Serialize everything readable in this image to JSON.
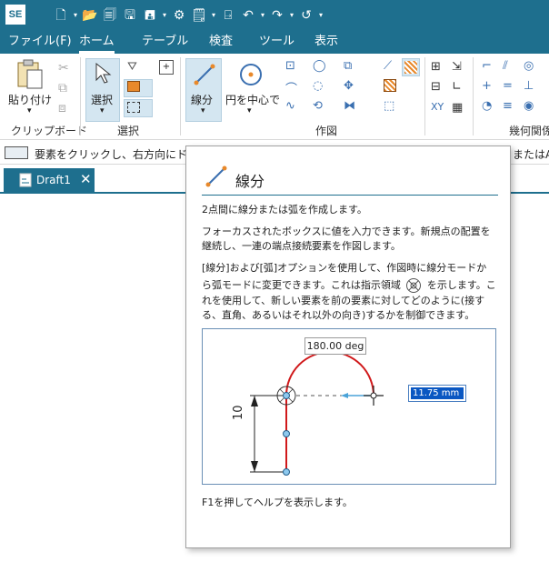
{
  "app": {
    "logo": "SE"
  },
  "tabs": [
    "ファイル(F)",
    "ホーム",
    "テーブル",
    "検査",
    "ツール",
    "表示"
  ],
  "ribbon": {
    "paste_label": "貼り付け",
    "clipboard_group": "クリップボード",
    "select_label": "選択",
    "select_group": "選択",
    "line_label": "線分",
    "circle_label": "円を中心で",
    "draw_group": "作図",
    "xy_label": "XY",
    "relations_group": "幾何関係"
  },
  "prompt": {
    "text": "要素をクリックし、右方向にドラッ",
    "text_right": "またはA"
  },
  "document": {
    "tab_label": "Draft1",
    "close_glyph": "✕"
  },
  "tooltip": {
    "title": "線分",
    "p1": "2点間に線分または弧を作成します。",
    "p2_line1": "フォーカスされたボックスに値を入力できます。新規点の配置を",
    "p2_line2": "継続し、一連の端点接続要素を作図します。",
    "p3_line1": "[線分]および[弧]オプションを使用して、作図時に線分モードか",
    "p3_line2a": "ら弧モードに変更できます。これは指示領域",
    "p3_line2b": "を示します。こ",
    "p3_line3": "れを使用して、新しい要素を前の要素に対してどのように(接す",
    "p3_line4": "る、直角、あるいはそれ以外の向き)するかを制御できます。",
    "angle_label": "180.00 deg",
    "length_value": "11.75 mm",
    "dim_label": "10",
    "footer": "F1を押してヘルプを表示します。"
  },
  "colors": {
    "accent": "#1e6f8e",
    "arc": "#d0191b",
    "highlight": "#0a57c2"
  }
}
